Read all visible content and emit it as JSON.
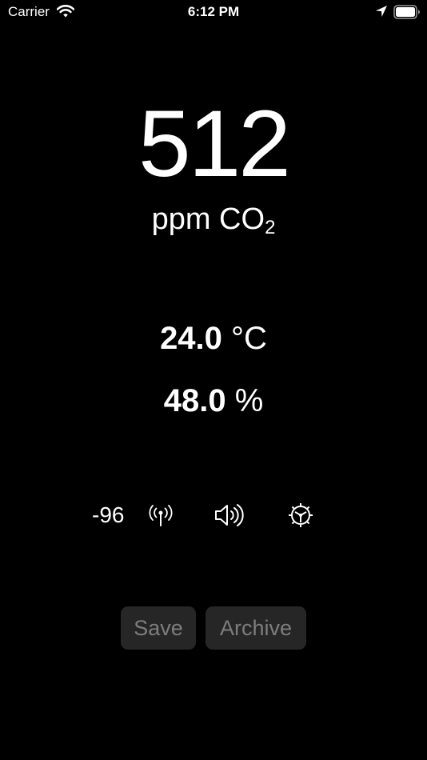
{
  "status_bar": {
    "carrier": "Carrier",
    "time": "6:12 PM",
    "icons": [
      "wifi-icon",
      "location-icon",
      "battery-icon"
    ]
  },
  "readings": {
    "co2_value": "512",
    "co2_unit_main": "ppm CO",
    "co2_unit_sub": "2",
    "temperature_value": "24.0",
    "temperature_unit": "°C",
    "humidity_value": "48.0",
    "humidity_unit": "%"
  },
  "controls": {
    "rssi": "-96",
    "icons": [
      "antenna-icon",
      "speaker-icon",
      "gear-icon"
    ]
  },
  "buttons": {
    "save_label": "Save",
    "archive_label": "Archive"
  },
  "colors": {
    "background": "#000000",
    "text": "#ffffff",
    "button_background": "#262626",
    "button_text": "#7d7d7d"
  }
}
